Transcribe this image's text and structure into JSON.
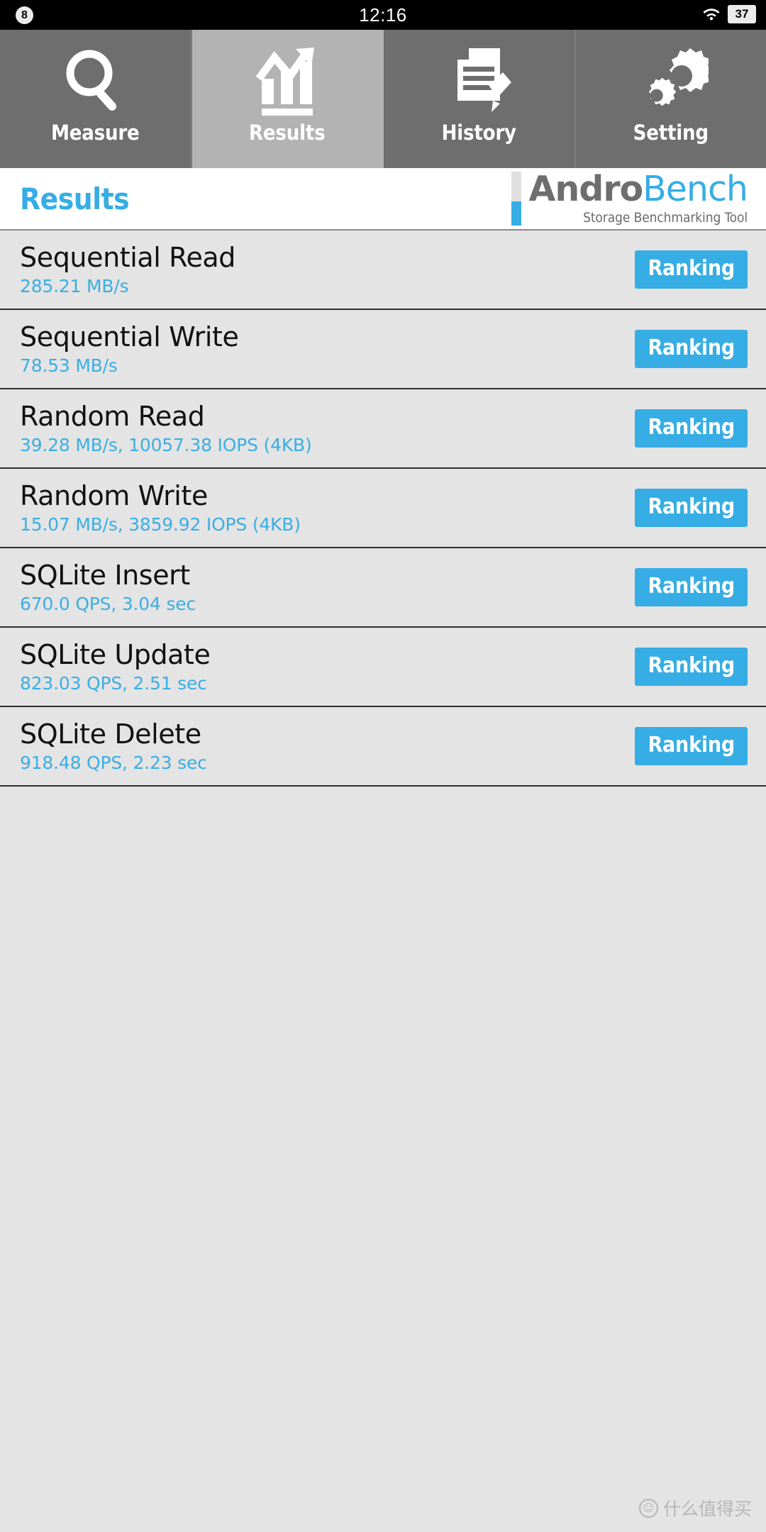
{
  "status_bar": {
    "notification_badge": "8",
    "clock": "12:16",
    "wifi_icon": "wifi-icon",
    "battery_level": "37"
  },
  "tab_bar": {
    "tabs": [
      {
        "label": "Measure",
        "icon": "magnifier-icon",
        "selected": false
      },
      {
        "label": "Results",
        "icon": "bar-chart-icon",
        "selected": true
      },
      {
        "label": "History",
        "icon": "document-edit-icon",
        "selected": false
      },
      {
        "label": "Setting",
        "icon": "gears-icon",
        "selected": false
      }
    ],
    "inactive_color": "#6e6e6e",
    "selected_color": "#b3b3b3"
  },
  "header": {
    "title": "Results",
    "brand_name_part1": "Andro",
    "brand_name_part2": "Bench",
    "brand_tagline": "Storage Benchmarking Tool",
    "accent_color": "#36ade4",
    "brand_gray": "#6e6e6e"
  },
  "results": {
    "button_label": "Ranking",
    "rows": [
      {
        "title": "Sequential Read",
        "value": "285.21 MB/s"
      },
      {
        "title": "Sequential Write",
        "value": "78.53 MB/s"
      },
      {
        "title": "Random Read",
        "value": "39.28 MB/s, 10057.38 IOPS (4KB)"
      },
      {
        "title": "Random Write",
        "value": "15.07 MB/s, 3859.92 IOPS (4KB)"
      },
      {
        "title": "SQLite Insert",
        "value": "670.0 QPS, 3.04 sec"
      },
      {
        "title": "SQLite Update",
        "value": "823.03 QPS, 2.51 sec"
      },
      {
        "title": "SQLite Delete",
        "value": "918.48 QPS, 2.23 sec"
      }
    ]
  },
  "watermark": {
    "text": "什么值得买",
    "icon": "smiley-circle-icon"
  }
}
